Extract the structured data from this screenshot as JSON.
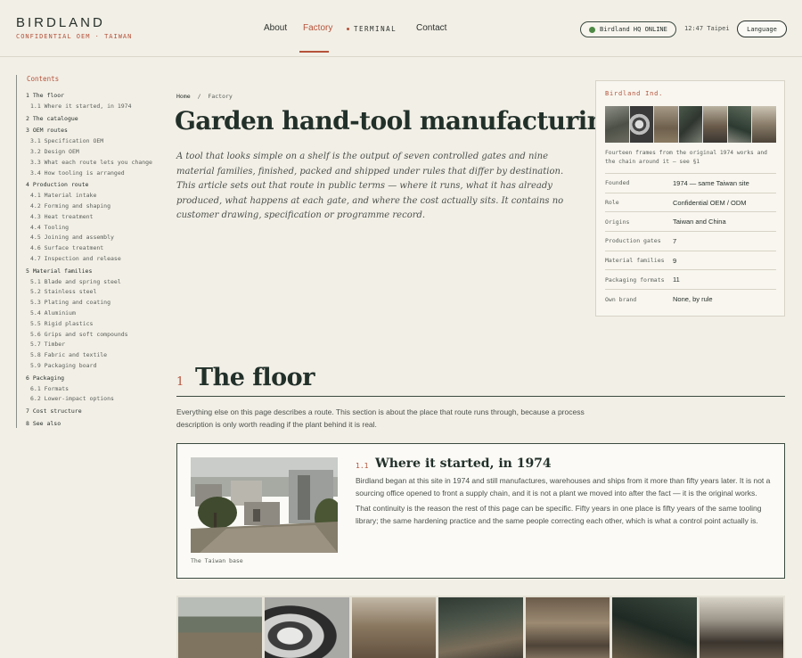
{
  "brand": {
    "name": "BIRDLAND",
    "subtitle": "CONFIDENTIAL OEM · TAIWAN"
  },
  "nav": {
    "about": "About",
    "factory": "Factory",
    "terminal": "TERMINAL",
    "contact": "Contact"
  },
  "status": {
    "label": "Birdland HQ ONLINE",
    "clock": "12:47 Taipei",
    "language": "Language",
    "online_color": "#4e8a45"
  },
  "toc": {
    "title": "Contents",
    "items": [
      {
        "label": "1 The floor",
        "level": 1
      },
      {
        "label": "1.1 Where it started, in 1974",
        "level": 2
      },
      {
        "label": "2 The catalogue",
        "level": 1
      },
      {
        "label": "3 OEM routes",
        "level": 1
      },
      {
        "label": "3.1 Specification OEM",
        "level": 2
      },
      {
        "label": "3.2 Design OEM",
        "level": 2
      },
      {
        "label": "3.3 What each route lets you change",
        "level": 2
      },
      {
        "label": "3.4 How tooling is arranged",
        "level": 2
      },
      {
        "label": "4 Production route",
        "level": 1
      },
      {
        "label": "4.1 Material intake",
        "level": 2
      },
      {
        "label": "4.2 Forming and shaping",
        "level": 2
      },
      {
        "label": "4.3 Heat treatment",
        "level": 2
      },
      {
        "label": "4.4 Tooling",
        "level": 2
      },
      {
        "label": "4.5 Joining and assembly",
        "level": 2
      },
      {
        "label": "4.6 Surface treatment",
        "level": 2
      },
      {
        "label": "4.7 Inspection and release",
        "level": 2
      },
      {
        "label": "5 Material families",
        "level": 1
      },
      {
        "label": "5.1 Blade and spring steel",
        "level": 2
      },
      {
        "label": "5.2 Stainless steel",
        "level": 2
      },
      {
        "label": "5.3 Plating and coating",
        "level": 2
      },
      {
        "label": "5.4 Aluminium",
        "level": 2
      },
      {
        "label": "5.5 Rigid plastics",
        "level": 2
      },
      {
        "label": "5.6 Grips and soft compounds",
        "level": 2
      },
      {
        "label": "5.7 Timber",
        "level": 2
      },
      {
        "label": "5.8 Fabric and textile",
        "level": 2
      },
      {
        "label": "5.9 Packaging board",
        "level": 2
      },
      {
        "label": "6 Packaging",
        "level": 1
      },
      {
        "label": "6.1 Formats",
        "level": 2
      },
      {
        "label": "6.2 Lower-impact options",
        "level": 2
      },
      {
        "label": "7 Cost structure",
        "level": 1
      },
      {
        "label": "8 See also",
        "level": 1
      }
    ]
  },
  "breadcrumb": {
    "home": "Home",
    "separator": "/",
    "current": "Factory"
  },
  "page": {
    "title": "Garden hand-tool manufacturing",
    "lede": "A tool that looks simple on a shelf is the output of seven controlled gates and nine material families, finished, packed and shipped under rules that differ by destination. This article sets out that route in public terms — where it runs, what it has already produced, what happens at each gate, and where the cost actually sits. It contains no customer drawing, specification or programme record."
  },
  "infobox": {
    "title": "Birdland Ind.",
    "caption": "Fourteen frames from the original 1974 works and the chain around it — see §1",
    "facts": [
      {
        "label": "Founded",
        "value": "1974 — same Taiwan site"
      },
      {
        "label": "Role",
        "value": "Confidential OEM / ODM"
      },
      {
        "label": "Origins",
        "value": "Taiwan and China"
      },
      {
        "label": "Production gates",
        "value": "7"
      },
      {
        "label": "Material families",
        "value": "9"
      },
      {
        "label": "Packaging formats",
        "value": "11"
      },
      {
        "label": "Own brand",
        "value": "None, by rule"
      }
    ]
  },
  "section1": {
    "number": "1",
    "title": "The floor",
    "intro": "Everything else on this page describes a route. This section is about the place that route runs through, because a process description is only worth reading if the plant behind it is real.",
    "sub": {
      "number": "1.1",
      "title": "Where it started, in 1974",
      "photo_caption": "The Taiwan base",
      "paragraphs": [
        "Birdland began at this site in 1974 and still manufactures, warehouses and ships from it more than fifty years later. It is not a sourcing office opened to front a supply chain, and it is not a plant we moved into after the fact — it is the original works.",
        "That continuity is the reason the rest of this page can be specific. Fifty years in one place is fifty years of the same tooling library; the same hardening practice and the same people correcting each other, which is what a control point actually is."
      ]
    }
  },
  "colors": {
    "accent": "#b5523a",
    "ink": "#22302a",
    "background": "#f2efe6"
  }
}
